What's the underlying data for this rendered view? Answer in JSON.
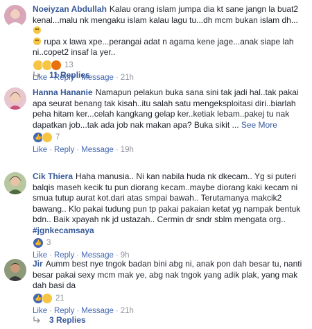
{
  "colors": {
    "link": "#365899",
    "meta": "#90949c",
    "like": "#4267b2",
    "text": "#1d2129"
  },
  "comments": [
    {
      "author": "Noeiyzan Abdullah",
      "text1": "Kalau orang islam jumpa dia kt sane jangn la buat2 kenal...malu nk mengaku islam kalau lagu tu...dh mcm bukan islam dh...",
      "text2": " rupa x lawa xpe...perangai adat n agama kene jage...anak siape lah ni..copet2 insaf la yer..",
      "reaction_count": "13",
      "actions": {
        "like": "Like",
        "reply": "Reply",
        "message": "Message",
        "time": "21h"
      },
      "replies": "11 Replies"
    },
    {
      "author": "Hanna Hananie",
      "text": "Namapun pelakun buka sana sini tak jadi hal..tak pakai apa seurat benang tak kisah..itu salah satu mengeksploitasi diri..biarlah peha hitam ker...celah kangkang gelap ker..ketiak lebam..pakej tu nak dapatkan job...tak ada job nak makan apa? Buka sikit ...",
      "see_more": "See More",
      "reaction_count": "7",
      "actions": {
        "like": "Like",
        "reply": "Reply",
        "message": "Message",
        "time": "19h"
      }
    },
    {
      "author": "Cik Thiera",
      "text": "Haha manusia.. Ni kan nabila huda nk dkecam.. Yg si puteri balqis maseh kecik tu pun diorang kecam..maybe diorang kaki kecam ni smua tutup aurat kot.dari atas smpai bawah.. Terutamanya makcik2 bawang.. Klo pakai tudung pun tp pakai pakaian ketat yg nampak bentuk bdn.. Baik xpayah nk jd ustazah.. Cermin dr sndr sblm mengata org..",
      "hashtag": "#jgnkecamsaya",
      "reaction_count": "3",
      "actions": {
        "like": "Like",
        "reply": "Reply",
        "message": "Message",
        "time": "9h"
      }
    },
    {
      "author": "Jir",
      "text": "Aumm best nye tngok badan bini abg ni, anak pon dah besar tu, nanti besar pakai sexy mcm mak ye, abg nak tngok yang adik plak, yang mak dah basi da",
      "reaction_count": "21",
      "actions": {
        "like": "Like",
        "reply": "Reply",
        "message": "Message",
        "time": "21h"
      },
      "replies": "3 Replies"
    }
  ]
}
